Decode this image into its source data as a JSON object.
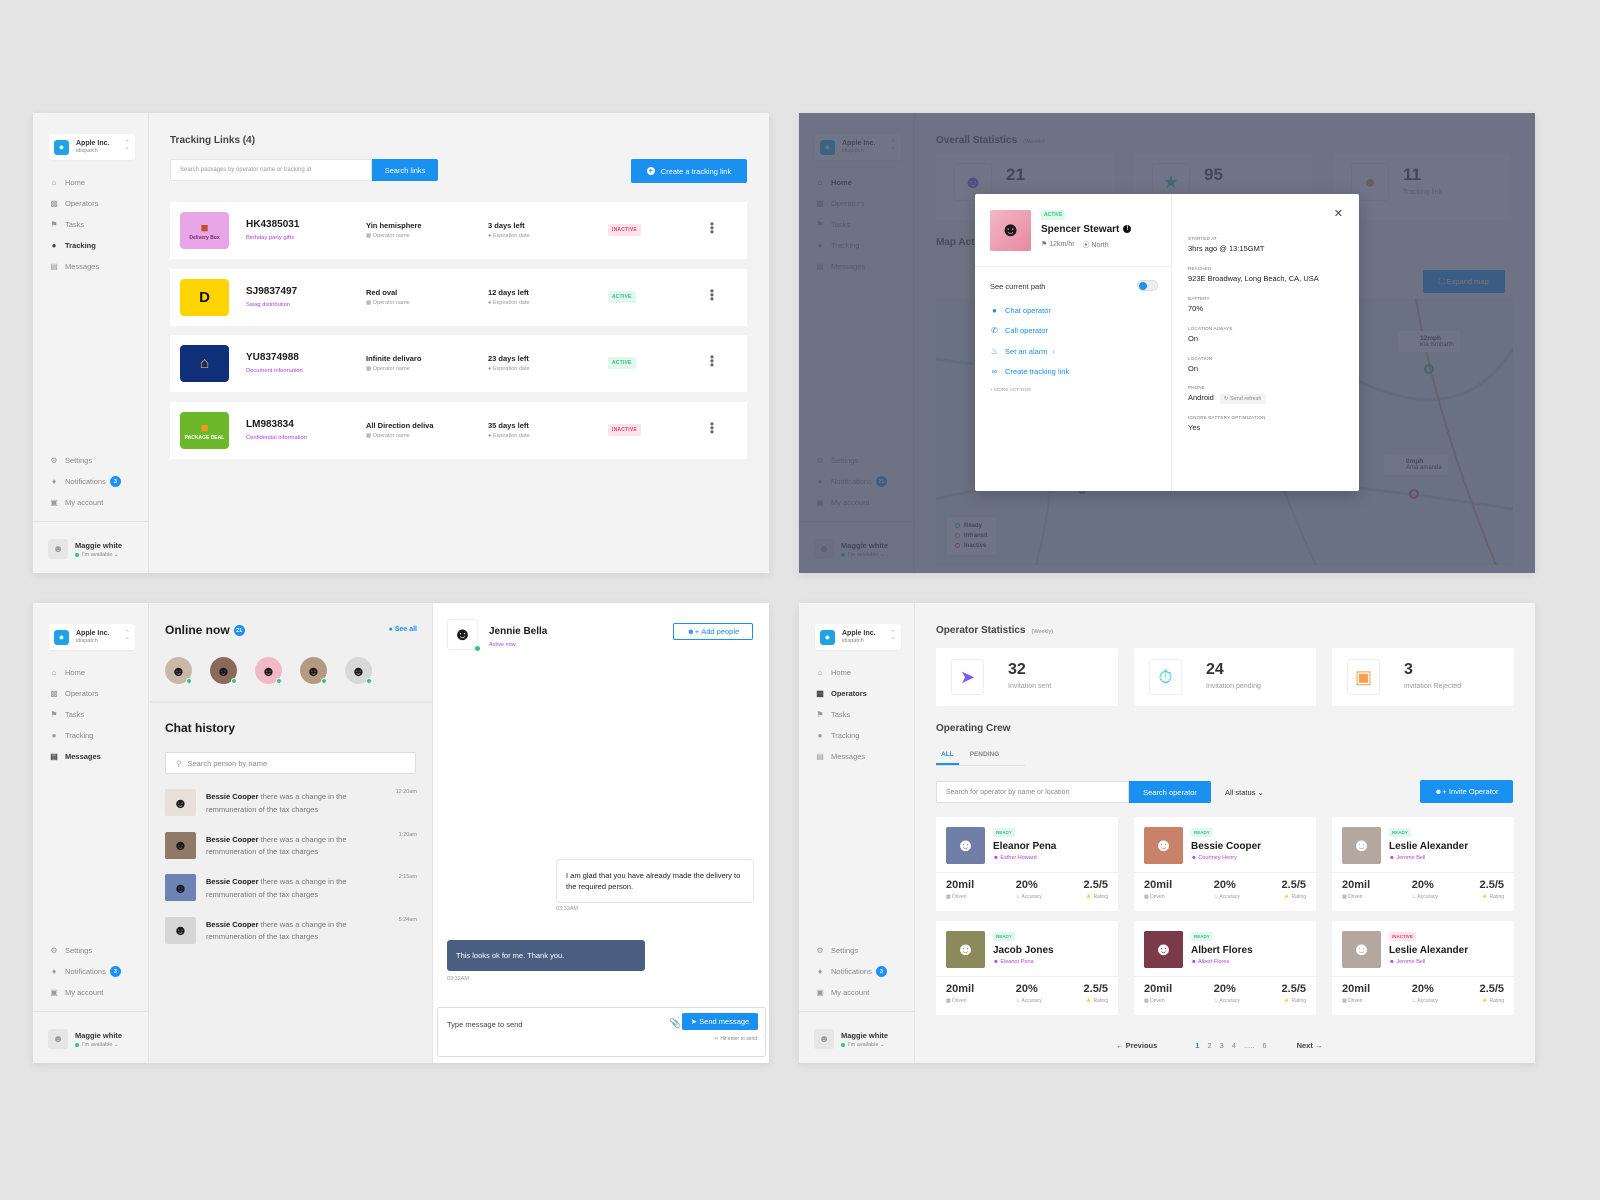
{
  "sidebar": {
    "org_name": "Apple Inc.",
    "org_sub": "idispatch",
    "nav": [
      "Home",
      "Operators",
      "Tasks",
      "Tracking",
      "Messages"
    ],
    "bottom": [
      "Settings",
      "Notifications",
      "My account"
    ],
    "user_name": "Maggie white",
    "user_status": "I'm available",
    "notifications_count_default": "3",
    "notifications_count_dimmed": "21"
  },
  "tracking": {
    "title": "Tracking Links (4)",
    "search_placeholder": "Search packages by operator name or tracking id",
    "search_button": "Search links",
    "create_button": "Create a tracking link",
    "rows": [
      {
        "logo_text": "Delivery Box",
        "id": "HK4385031",
        "sub": "Birthday party gifts",
        "operator": "Yin hemisphere",
        "operator_label": "Operator name",
        "days": "3 days left",
        "days_label": "Expiration date",
        "status": "INACTIVE"
      },
      {
        "logo_text": "D",
        "id": "SJ9837497",
        "sub": "Swag distribution",
        "operator": "Red oval",
        "operator_label": "Operator name",
        "days": "12 days left",
        "days_label": "Expiration date",
        "status": "ACTIVE"
      },
      {
        "logo_text": "",
        "id": "YU8374988",
        "sub": "Document information",
        "operator": "Infinite delivaro",
        "operator_label": "Operator name",
        "days": "23 days left",
        "days_label": "Expiration date",
        "status": "ACTIVE"
      },
      {
        "logo_text": "PACKAGE DEAL",
        "id": "LM983834",
        "sub": "Confidential information",
        "operator": "All Direction deliva",
        "operator_label": "Operator name",
        "days": "35 days left",
        "days_label": "Expiration date",
        "status": "INACTIVE"
      }
    ]
  },
  "dashboard": {
    "title": "Overall Statistics",
    "weekly": "(Weekly)",
    "stats": [
      {
        "value": "21",
        "label": ""
      },
      {
        "value": "95",
        "label": ""
      },
      {
        "value": "11",
        "label": "Tracking link"
      }
    ],
    "map_title": "Map Act",
    "expand_map": "Expand map",
    "map_popups": [
      {
        "speed": "12mph",
        "name": "Kia Ismbarth"
      },
      {
        "speed": "0mph",
        "name": "Ama amanda"
      }
    ],
    "legend": [
      "Ready",
      "Intransit",
      "Inactive"
    ]
  },
  "modal": {
    "status": "ACTIVE",
    "name": "Spencer Stewart",
    "speed": "12km/hr",
    "direction": "North",
    "see_path": "See current path",
    "actions": [
      "Chat operator",
      "Call operator",
      "Set an alarm",
      "Create tracking link"
    ],
    "more_actions": "+ MORE ACTIONS",
    "details": [
      {
        "label": "STARTED AT",
        "value": "3hrs ago @ 13:15GMT"
      },
      {
        "label": "REACHED",
        "value": "923E Broadway, Long Beach, CA, USA"
      },
      {
        "label": "BATTERY",
        "value": "70%"
      },
      {
        "label": "LOCATION ALWAYS",
        "value": "On"
      },
      {
        "label": "LOCATION",
        "value": "On"
      },
      {
        "label": "PHONE",
        "value": "Android"
      },
      {
        "label": "IGNORE BATTERY OPTIMIZATION",
        "value": "Yes"
      }
    ],
    "send_refresh": "Send refresh"
  },
  "chat": {
    "online_title": "Online now",
    "online_count": "21",
    "see_all": "See all",
    "history_title": "Chat history",
    "search_placeholder": "Search person by name",
    "items": [
      {
        "name": "Bessie Cooper",
        "text": "there was a change in the remmuneration of the tax charges",
        "time": "12:20am"
      },
      {
        "name": "Bessie Cooper",
        "text": "there was a change in the remmuneration of the tax charges",
        "time": "1:20am"
      },
      {
        "name": "Bessie Cooper",
        "text": "there was a change in the remmuneration of the tax charges",
        "time": "2:15am"
      },
      {
        "name": "Bessie Cooper",
        "text": "there was a change in the remmuneration of the tax charges",
        "time": "5:24am"
      }
    ],
    "contact_name": "Jennie Bella",
    "contact_status": "Active now",
    "add_people": "Add people",
    "messages": [
      {
        "text": "I am glad that you have already made the delivery to the required person.",
        "time": "03:32AM"
      },
      {
        "text": "This looks ok for me. Thank you.",
        "time": "03:32AM"
      }
    ],
    "composer_placeholder": "Type message to send",
    "send_button": "Send message",
    "hint": "Hit enter to send"
  },
  "operators": {
    "title": "Operator Statistics",
    "weekly": "(Weekly)",
    "stats": [
      {
        "value": "32",
        "label": "Invitation sent"
      },
      {
        "value": "24",
        "label": "Invitation pending"
      },
      {
        "value": "3",
        "label": "invitation Rejected"
      }
    ],
    "crew_title": "Operating Crew",
    "tabs": [
      "ALL",
      "PENDING"
    ],
    "search_placeholder": "Search for operator by name or location",
    "search_button": "Search operator",
    "status_filter": "All status",
    "invite_button": "Invite Operator",
    "cards": [
      {
        "status": "READY",
        "name": "Eleanor Pena",
        "sub": "Esther Howard",
        "driven": "20mil",
        "accuracy": "20%",
        "rating": "2.5/5"
      },
      {
        "status": "READY",
        "name": "Bessie Cooper",
        "sub": "Courtney Henry",
        "driven": "20mil",
        "accuracy": "20%",
        "rating": "2.5/5"
      },
      {
        "status": "READY",
        "name": "Leslie Alexander",
        "sub": "Jerome Bell",
        "driven": "20mil",
        "accuracy": "20%",
        "rating": "2.5/5"
      },
      {
        "status": "READY",
        "name": "Jacob Jones",
        "sub": "Eleanor Pena",
        "driven": "20mil",
        "accuracy": "20%",
        "rating": "2.5/5"
      },
      {
        "status": "READY",
        "name": "Albert Flores",
        "sub": "Albert Flores",
        "driven": "20mil",
        "accuracy": "20%",
        "rating": "2.5/5"
      },
      {
        "status": "INACTIVE",
        "name": "Leslie Alexander",
        "sub": "Jerome Bell",
        "driven": "20mil",
        "accuracy": "20%",
        "rating": "2.5/5"
      }
    ],
    "metric_labels": [
      "Driven",
      "Accuracy",
      "Rating"
    ],
    "pagination": {
      "previous": "Previous",
      "pages": [
        "1",
        "2",
        "3",
        "4",
        ".....",
        "6"
      ],
      "next": "Next"
    }
  }
}
